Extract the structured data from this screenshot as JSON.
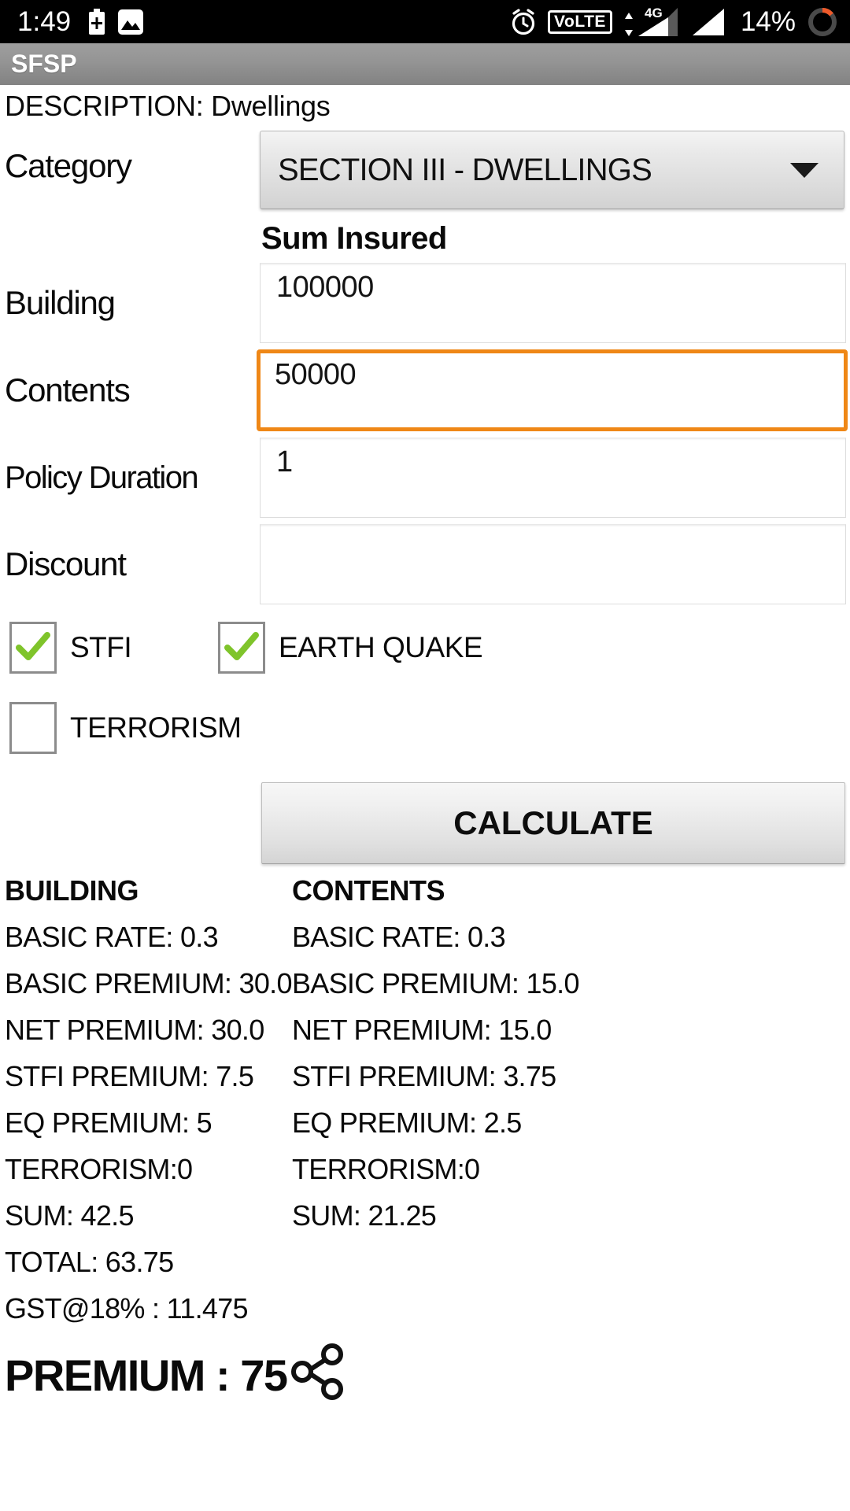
{
  "status_bar": {
    "time": "1:49",
    "battery_percent": "14%",
    "network_type": "4G",
    "volte_label": "VoLTE",
    "icons": [
      "battery-charge-icon",
      "image-icon",
      "alarm-icon",
      "volte-icon",
      "signal-icon-1",
      "signal-icon-2",
      "battery-ring-icon"
    ]
  },
  "app_bar": {
    "title": "SFSP"
  },
  "form": {
    "description": "DESCRIPTION: Dwellings",
    "category": {
      "label": "Category",
      "value": "SECTION III - DWELLINGS"
    },
    "sum_insured_heading": "Sum Insured",
    "building": {
      "label": "Building",
      "value": "100000",
      "focused": false
    },
    "contents": {
      "label": "Contents",
      "value": "50000",
      "focused": true
    },
    "policy_duration": {
      "label": "Policy Duration",
      "value": "1",
      "focused": false
    },
    "discount": {
      "label": "Discount",
      "value": "",
      "focused": false
    },
    "checkboxes": [
      {
        "label": "STFI",
        "checked": true
      },
      {
        "label": "EARTH QUAKE",
        "checked": true
      },
      {
        "label": "TERRORISM",
        "checked": false
      }
    ],
    "calculate_label": "CALCULATE"
  },
  "results": {
    "building_heading": "BUILDING",
    "contents_heading": "CONTENTS",
    "rows": [
      {
        "building": "BASIC RATE: 0.3",
        "contents": "BASIC RATE: 0.3"
      },
      {
        "building": "BASIC PREMIUM: 30.0",
        "contents": "BASIC PREMIUM: 15.0"
      },
      {
        "building": "NET PREMIUM: 30.0",
        "contents": "NET PREMIUM: 15.0"
      },
      {
        "building": "STFI PREMIUM: 7.5",
        "contents": "STFI PREMIUM: 3.75"
      },
      {
        "building": "EQ PREMIUM: 5",
        "contents": "EQ PREMIUM: 2.5"
      },
      {
        "building": "TERRORISM:0",
        "contents": "TERRORISM:0"
      },
      {
        "building": "SUM: 42.5",
        "contents": "SUM: 21.25"
      }
    ],
    "total": "TOTAL: 63.75",
    "gst": "GST@18% : 11.475",
    "premium": "PREMIUM : 75"
  },
  "colors": {
    "focus_orange": "#ef8716",
    "check_green": "#7fc42b",
    "app_bar_gray": "#949494",
    "status_black": "#000000"
  }
}
